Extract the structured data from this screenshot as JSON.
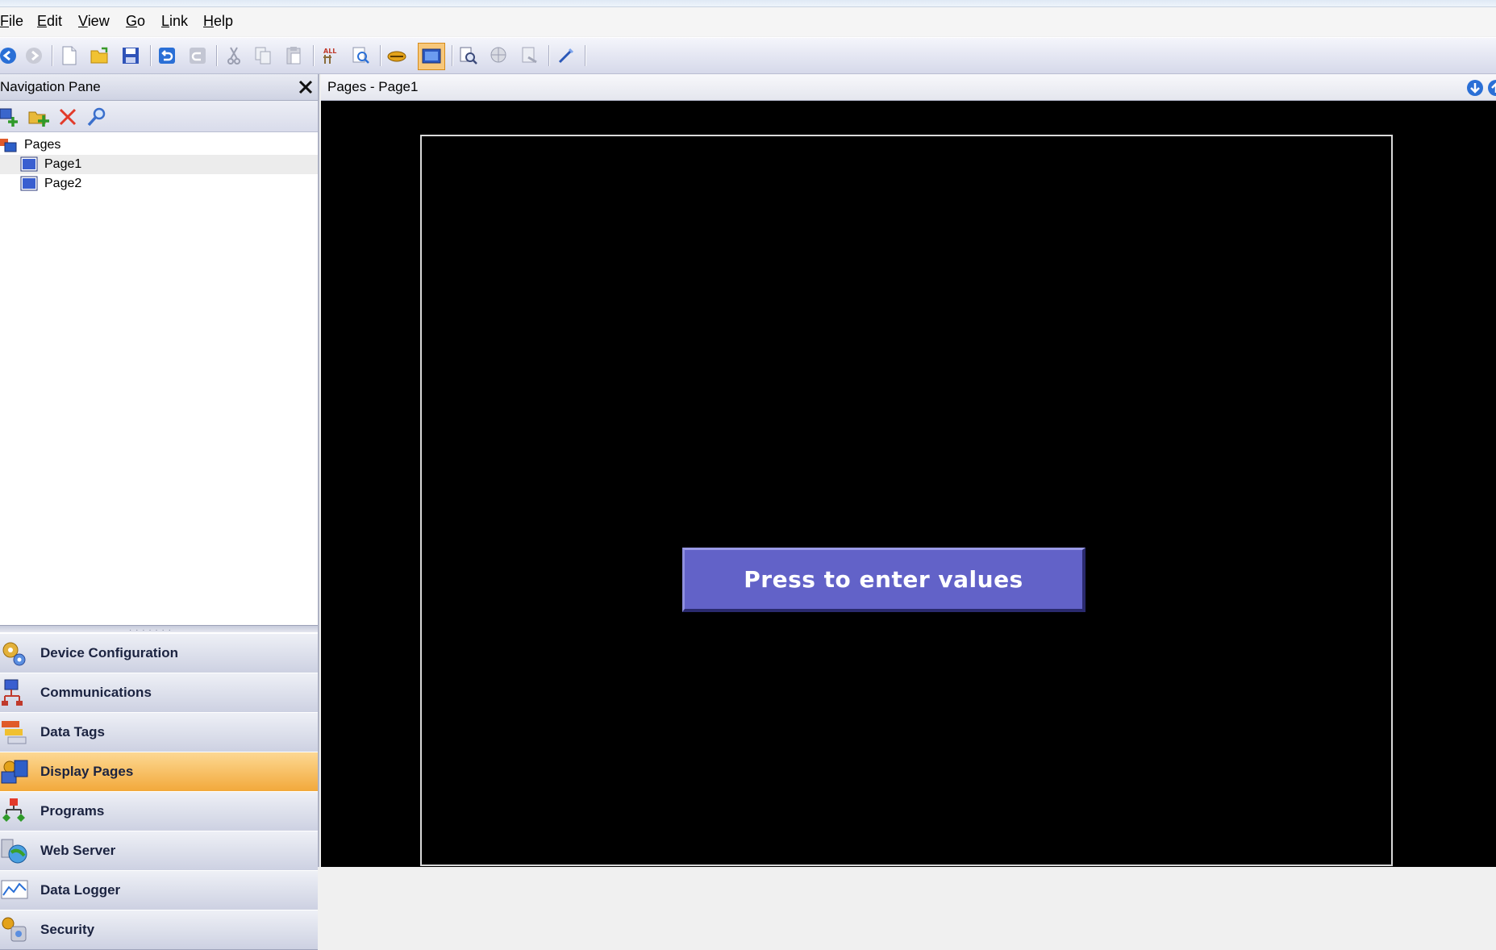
{
  "menu": [
    "File",
    "Edit",
    "View",
    "Go",
    "Link",
    "Help"
  ],
  "navigation_pane": {
    "title": "Navigation Pane",
    "tree": {
      "root": "Pages",
      "children": [
        "Page1",
        "Page2"
      ],
      "selected": "Page1"
    }
  },
  "sections": [
    {
      "label": "Device Configuration",
      "icon": "gear-icon"
    },
    {
      "label": "Communications",
      "icon": "network-icon"
    },
    {
      "label": "Data Tags",
      "icon": "tags-icon"
    },
    {
      "label": "Display Pages",
      "icon": "display-pages-icon",
      "active": true
    },
    {
      "label": "Programs",
      "icon": "program-flow-icon"
    },
    {
      "label": "Web Server",
      "icon": "globe-icon"
    },
    {
      "label": "Data Logger",
      "icon": "chart-icon"
    },
    {
      "label": "Security",
      "icon": "security-icon"
    }
  ],
  "workspace": {
    "title": "Pages - Page1",
    "button_label": "Press to enter values"
  },
  "colors": {
    "accent": "#f2a93b",
    "hmi_button": "#6262c8",
    "canvas": "#000000"
  }
}
